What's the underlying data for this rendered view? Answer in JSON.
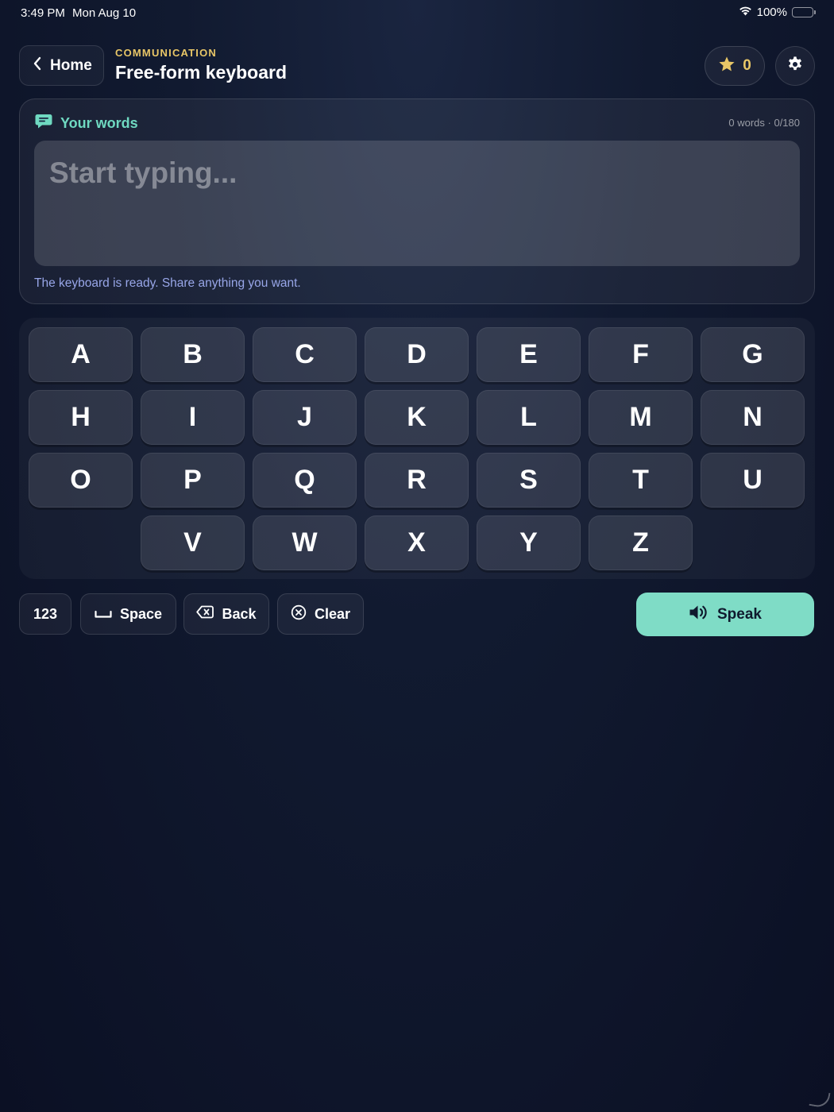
{
  "status_bar": {
    "time": "3:49 PM",
    "date": "Mon Aug 10",
    "battery": "100%"
  },
  "header": {
    "back_label": "Home",
    "eyebrow": "COMMUNICATION",
    "title": "Free-form keyboard",
    "stars": "0"
  },
  "words_card": {
    "title": "Your words",
    "count": "0 words · 0/180",
    "placeholder": "Start typing...",
    "hint": "The keyboard is ready. Share anything you want."
  },
  "keyboard": {
    "rows": [
      [
        "A",
        "B",
        "C",
        "D",
        "E",
        "F",
        "G"
      ],
      [
        "H",
        "I",
        "J",
        "K",
        "L",
        "M",
        "N"
      ],
      [
        "O",
        "P",
        "Q",
        "R",
        "S",
        "T",
        "U"
      ],
      [
        "V",
        "W",
        "X",
        "Y",
        "Z"
      ]
    ]
  },
  "actions": {
    "numbers_label": "123",
    "space_label": "Space",
    "back_label": "Back",
    "clear_label": "Clear",
    "speak_label": "Speak"
  },
  "colors": {
    "accent_teal": "#7fdcc6",
    "accent_gold": "#e8c667",
    "hint_blue": "#98a6e8"
  },
  "icons": {
    "back": "chevron-left-icon",
    "star": "star-icon",
    "settings": "gear-icon",
    "chat": "chat-bubble-icon",
    "space": "space-bar-icon",
    "backspace": "backspace-icon",
    "clear": "clear-circle-icon",
    "speaker": "speaker-icon"
  }
}
